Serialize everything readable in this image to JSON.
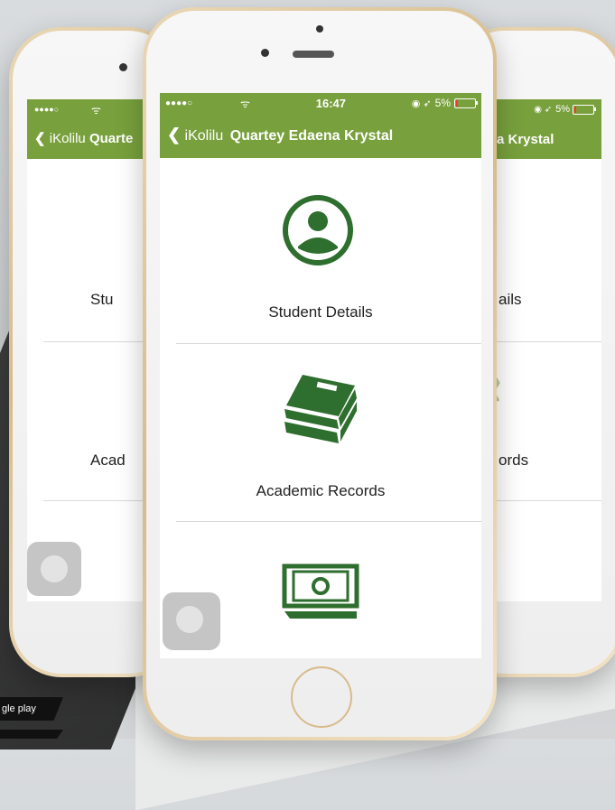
{
  "colors": {
    "brand_green": "#78a03c",
    "icon_green": "#2e6e2e"
  },
  "front": {
    "status": {
      "time": "16:47",
      "battery": "5%",
      "signal": "●●●●○"
    },
    "nav": {
      "back_label": "iKolilu",
      "title": "Quartey Edaena Krystal"
    },
    "menu": [
      {
        "label": "Student Details",
        "icon": "user-circle-icon"
      },
      {
        "label": "Academic Records",
        "icon": "books-icon"
      },
      {
        "label": "",
        "icon": "money-icon"
      }
    ]
  },
  "left_phone": {
    "status": {
      "signal": "●●●●○"
    },
    "nav": {
      "back_label": "iKolilu",
      "title_fragment": "Quarte"
    },
    "menu": [
      {
        "label": "Stu"
      },
      {
        "label": "Acad"
      }
    ]
  },
  "right_phone": {
    "status": {
      "battery": "5%"
    },
    "nav": {
      "title_fragment": "a Krystal"
    },
    "menu": [
      {
        "label": "ails"
      },
      {
        "label": "ords"
      }
    ]
  },
  "badge": {
    "text": "gle play"
  }
}
